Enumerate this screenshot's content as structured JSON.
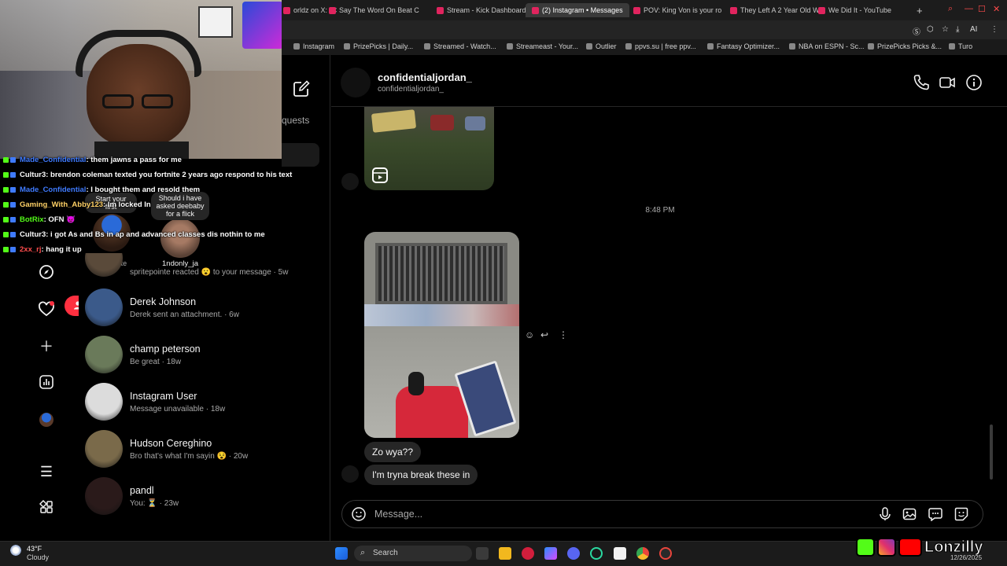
{
  "browser": {
    "tabs": [
      {
        "label": "orldz on X: \"C",
        "active": false
      },
      {
        "label": "Say The Word On Beat C",
        "active": false
      },
      {
        "label": "Stream - Kick Dashboard",
        "active": false
      },
      {
        "label": "(2) Instagram • Messages",
        "active": true
      },
      {
        "label": "POV: King Von is your ro",
        "active": false
      },
      {
        "label": "They Left A 2 Year Old W",
        "active": false
      },
      {
        "label": "We Did It - YouTube",
        "active": false
      }
    ],
    "new_tab": "+",
    "bookmarks": [
      "Instagram",
      "PrizePicks | Daily...",
      "Streamed - Watch...",
      "Streameast - Your...",
      "Outlier",
      "ppvs.su | free ppv...",
      "Fantasy Optimizer...",
      "NBA on ESPN - Sc...",
      "PrizePicks Picks &...",
      "Turo"
    ],
    "ai_label": "AI"
  },
  "nav": {
    "notification_count": "1",
    "requests_partial": "quests"
  },
  "notes": {
    "your_note_label": "Your note",
    "your_note_prompt": "Start your first",
    "friend_note_text": "Should i have asked deebaby for a flick",
    "friend_note_user": "1ndonly_ja"
  },
  "conversations": [
    {
      "name": "",
      "sub": "spritepointe reacted 😮 to your message · 5w",
      "color": "#5a4a3a"
    },
    {
      "name": "Derek Johnson",
      "sub": "Derek sent an attachment. · 6w",
      "color": "#3b5a8a"
    },
    {
      "name": "champ peterson",
      "sub": "Be great · 18w",
      "color": "#6a7a5a"
    },
    {
      "name": "Instagram User",
      "sub": "Message unavailable · 18w",
      "color": "#dcdcdc"
    },
    {
      "name": "Hudson Cereghino",
      "sub": "Bro that's what I'm sayin 😵 · 20w",
      "color": "#7a6a4a"
    },
    {
      "name": "pandl",
      "sub": "You: ⏳ · 23w",
      "color": "#2a1a1a"
    }
  ],
  "chat": {
    "contact_name": "confidentialjordan_",
    "contact_handle": "confidentialjordan_",
    "timestamp": "8:48 PM",
    "messages": [
      "Zo wya??",
      "I'm tryna break these in"
    ],
    "composer_placeholder": "Message..."
  },
  "stream_chat": [
    {
      "user": "Made_Confidential",
      "user_color": "#3f7bff",
      "text": ": them jawns a pass for me"
    },
    {
      "user": "Cultur3",
      "user_color": "#ffffff",
      "text": ": brendon coleman texted you fortnite 2 years ago respond to his text"
    },
    {
      "user": "Made_Confidential",
      "user_color": "#3f7bff",
      "text": ": I bought them and resold them"
    },
    {
      "user": "Gaming_With_Abby123",
      "user_color": "#ffd166",
      "text": ": Im locked In"
    },
    {
      "user": "BotRix",
      "user_color": "#53fc18",
      "text": ": OFN 👿"
    },
    {
      "user": "Cultur3",
      "user_color": "#ffffff",
      "text": ": i got As and Bs in ap and advanced classes dis nothin to me"
    },
    {
      "user": "2xx_rj",
      "user_color": "#ff4d4d",
      "text": ": hang it up"
    }
  ],
  "taskbar": {
    "temp": "43°F",
    "condition": "Cloudy",
    "search_label": "Search",
    "brand": "Lonzilly",
    "date": "12/26/2025"
  }
}
